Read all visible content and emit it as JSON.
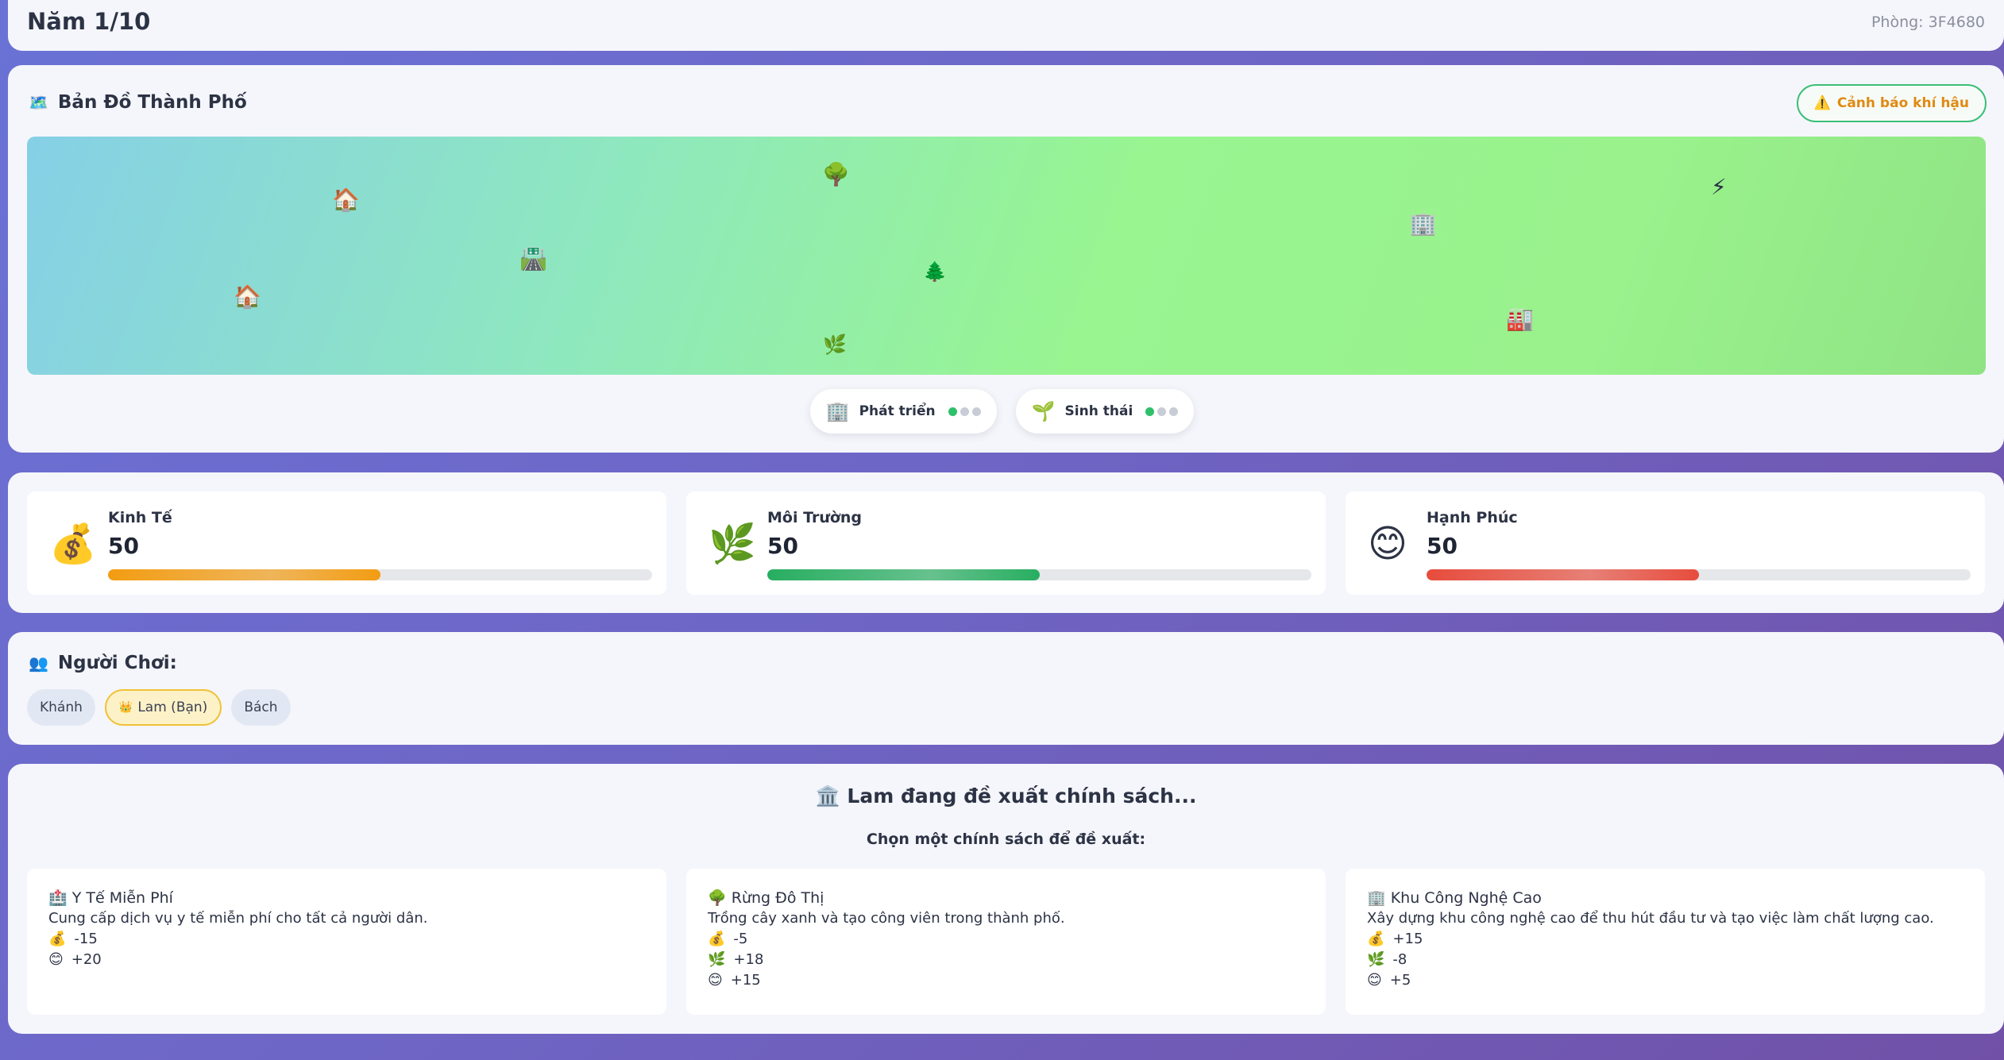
{
  "header": {
    "year": "Năm 1/10",
    "room": "Phòng: 3F4680"
  },
  "map": {
    "title": "Bản Đồ Thành Phố",
    "title_icon": "🗺️",
    "warning_button": "Cảnh báo khí hậu",
    "warning_icon": "⚠️",
    "items": [
      {
        "name": "house-icon",
        "glyph": "🏠"
      },
      {
        "name": "house-icon",
        "glyph": "🏠"
      },
      {
        "name": "road-icon",
        "glyph": "🛣️"
      },
      {
        "name": "tree-icon",
        "glyph": "🌳"
      },
      {
        "name": "pine-tree-icon",
        "glyph": "🌲"
      },
      {
        "name": "sprout-icon",
        "glyph": "🌿"
      },
      {
        "name": "office-building-icon",
        "glyph": "🏢"
      },
      {
        "name": "lightning-icon",
        "glyph": "⚡"
      },
      {
        "name": "factory-icon",
        "glyph": "🏭"
      }
    ],
    "toggles": [
      {
        "label": "Phát triển",
        "icon": "🏢",
        "level": 1,
        "max": 3
      },
      {
        "label": "Sinh thái",
        "icon": "🌱",
        "level": 1,
        "max": 3
      }
    ]
  },
  "stats": [
    {
      "label": "Kinh Tế",
      "value": "50",
      "emoji": "💰",
      "fill": 0.5,
      "color": "#f39c12"
    },
    {
      "label": "Môi Trường",
      "value": "50",
      "emoji": "🌿",
      "fill": 0.5,
      "color": "#27ae60"
    },
    {
      "label": "Hạnh Phúc",
      "value": "50",
      "emoji": "😊",
      "fill": 0.5,
      "color": "#e74c3c"
    }
  ],
  "players": {
    "title": "Người Chơi:",
    "icon": "👥",
    "list": [
      {
        "name": "Khánh",
        "is_me": false
      },
      {
        "name": "Lam (Bạn)",
        "is_me": true,
        "icon": "👑"
      },
      {
        "name": "Bách",
        "is_me": false
      }
    ]
  },
  "policy": {
    "title": "Lam đang đề xuất chính sách...",
    "title_icon": "🏛️",
    "subtitle": "Chọn một chính sách để đề xuất:",
    "cards": [
      {
        "icon": "🏥",
        "title": "Y Tế Miễn Phí",
        "desc": "Cung cấp dịch vụ y tế miễn phí cho tất cả người dân.",
        "effects": [
          {
            "icon": "💰",
            "value": "-15"
          },
          {
            "icon": "😊",
            "value": "+20"
          }
        ]
      },
      {
        "icon": "🌳",
        "title": "Rừng Đô Thị",
        "desc": "Trồng cây xanh và tạo công viên trong thành phố.",
        "effects": [
          {
            "icon": "💰",
            "value": "-5"
          },
          {
            "icon": "🌿",
            "value": "+18"
          },
          {
            "icon": "😊",
            "value": "+15"
          }
        ]
      },
      {
        "icon": "🏢",
        "title": "Khu Công Nghệ Cao",
        "desc": "Xây dựng khu công nghệ cao để thu hút đầu tư và tạo việc làm chất lượng cao.",
        "effects": [
          {
            "icon": "💰",
            "value": "+15"
          },
          {
            "icon": "🌿",
            "value": "-8"
          },
          {
            "icon": "😊",
            "value": "+5"
          }
        ]
      }
    ]
  }
}
